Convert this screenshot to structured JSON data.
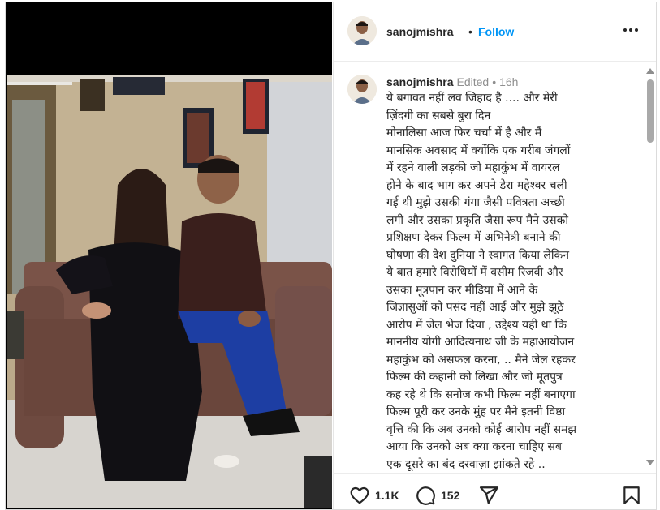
{
  "post": {
    "username": "sanojmishra",
    "follow_label": "Follow",
    "separator": "•"
  },
  "caption": {
    "username": "sanojmishra",
    "edited": "Edited",
    "separator": "•",
    "time": "16h",
    "text": "ये बगावत नहीं लव जिहाद है .... और मेरी\nज़िंदगी का सबसे बुरा दिन\nमोनालिसा आज फिर चर्चा में है और मैं\nमानसिक अवसाद में क्योंकि एक गरीब जंगलों\nमें रहने वाली लड़की जो महाकुंभ में वायरल\nहोने के बाद भाग कर अपने डेरा महेश्वर चली\nगई थी मुझे उसकी गंगा जैसी पवित्रता अच्छी\nलगी और उसका प्रकृति जैसा रूप मैने उसको\nप्रशिक्षण देकर फिल्म में अभिनेत्री बनाने की\nघोषणा की देश दुनिया ने स्वागत किया लेकिन\nये बात हमारे विरोधियों में वसीम रिजवी और\nउसका मूत्रपान कर मीडिया में आने के\nजिज्ञासुओं को पसंद नहीं आई और मुझे झूठे\nआरोप में जेल भेज दिया , उद्देश्य यही था कि\nमाननीय योगी आदित्यनाथ जी के महाआयोजन\nमहाकुंभ को असफल करना, .. मैने जेल रहकर\nफिल्म की कहानी को लिखा और जो मूतपुत्र\nकह रहे थे कि सनोज कभी फिल्म नहीं बनाएगा\nफिल्म पूरी कर उनके मुंह पर मैने इतनी विष्ठा\nवृत्ति की कि अब उनको कोई आरोप नहीं समझ\nआया कि उनको अब क्या करना चाहिए सब\nएक दूसरे का बंद दरवाज़ा झांकते रहे .."
  },
  "actions": {
    "likes": "1.1K",
    "comments": "152"
  },
  "icons": {
    "like": "heart-icon",
    "comment": "comment-icon",
    "share": "share-icon",
    "save": "bookmark-icon",
    "more": "more-options-icon"
  },
  "colors": {
    "follow": "#0095f6",
    "text": "#262626",
    "muted": "#8e8e8e"
  }
}
